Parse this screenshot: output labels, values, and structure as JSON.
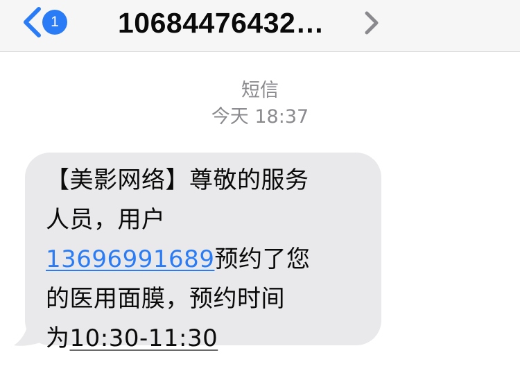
{
  "header": {
    "unread_count": "1",
    "sender": "10684476432…",
    "back_icon": "chevron-left-icon",
    "details_icon": "chevron-right-icon",
    "accent_color": "#2a7cf6"
  },
  "meta": {
    "kind": "短信",
    "time": "今天 18:37"
  },
  "message": {
    "line1": "【美影网络】尊敬的服务",
    "line2": "人员，用户",
    "phone": "13696991689",
    "line3_after_phone": "预约了您",
    "line4": "的医用面膜，预约时间",
    "line5_prefix": "为",
    "time_range": "10:30-11:30",
    "bubble_color": "#e9e9eb"
  }
}
